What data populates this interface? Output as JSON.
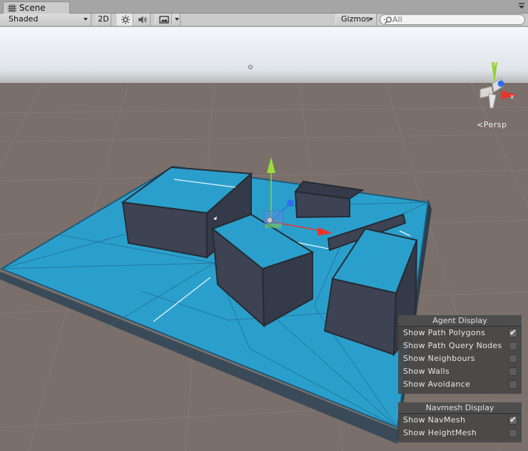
{
  "tab": {
    "title": "Scene"
  },
  "toolbar": {
    "shading_mode": "Shaded",
    "mode_2d_label": "2D",
    "gizmos_label": "Gizmos",
    "search_placeholder": "All"
  },
  "viewport": {
    "projection_label": "Persp",
    "axis_y": "y",
    "axis_x": "x"
  },
  "agent_display": {
    "title": "Agent Display",
    "options": [
      {
        "label": "Show Path Polygons",
        "checked": true
      },
      {
        "label": "Show Path Query Nodes",
        "checked": false
      },
      {
        "label": "Show Neighbours",
        "checked": false
      },
      {
        "label": "Show Walls",
        "checked": false
      },
      {
        "label": "Show Avoidance",
        "checked": false
      }
    ]
  },
  "navmesh_display": {
    "title": "Navmesh Display",
    "options": [
      {
        "label": "Show NavMesh",
        "checked": true
      },
      {
        "label": "Show HeightMesh",
        "checked": false
      }
    ]
  },
  "colors": {
    "navmesh": "#2b9fcc",
    "obstacle": "#3d4352",
    "ground": "#7a6f6a",
    "sky": "#e3e8ee",
    "gizmo_x": "#e8352a",
    "gizmo_y": "#8fd42a",
    "gizmo_z": "#2f6cf0"
  }
}
